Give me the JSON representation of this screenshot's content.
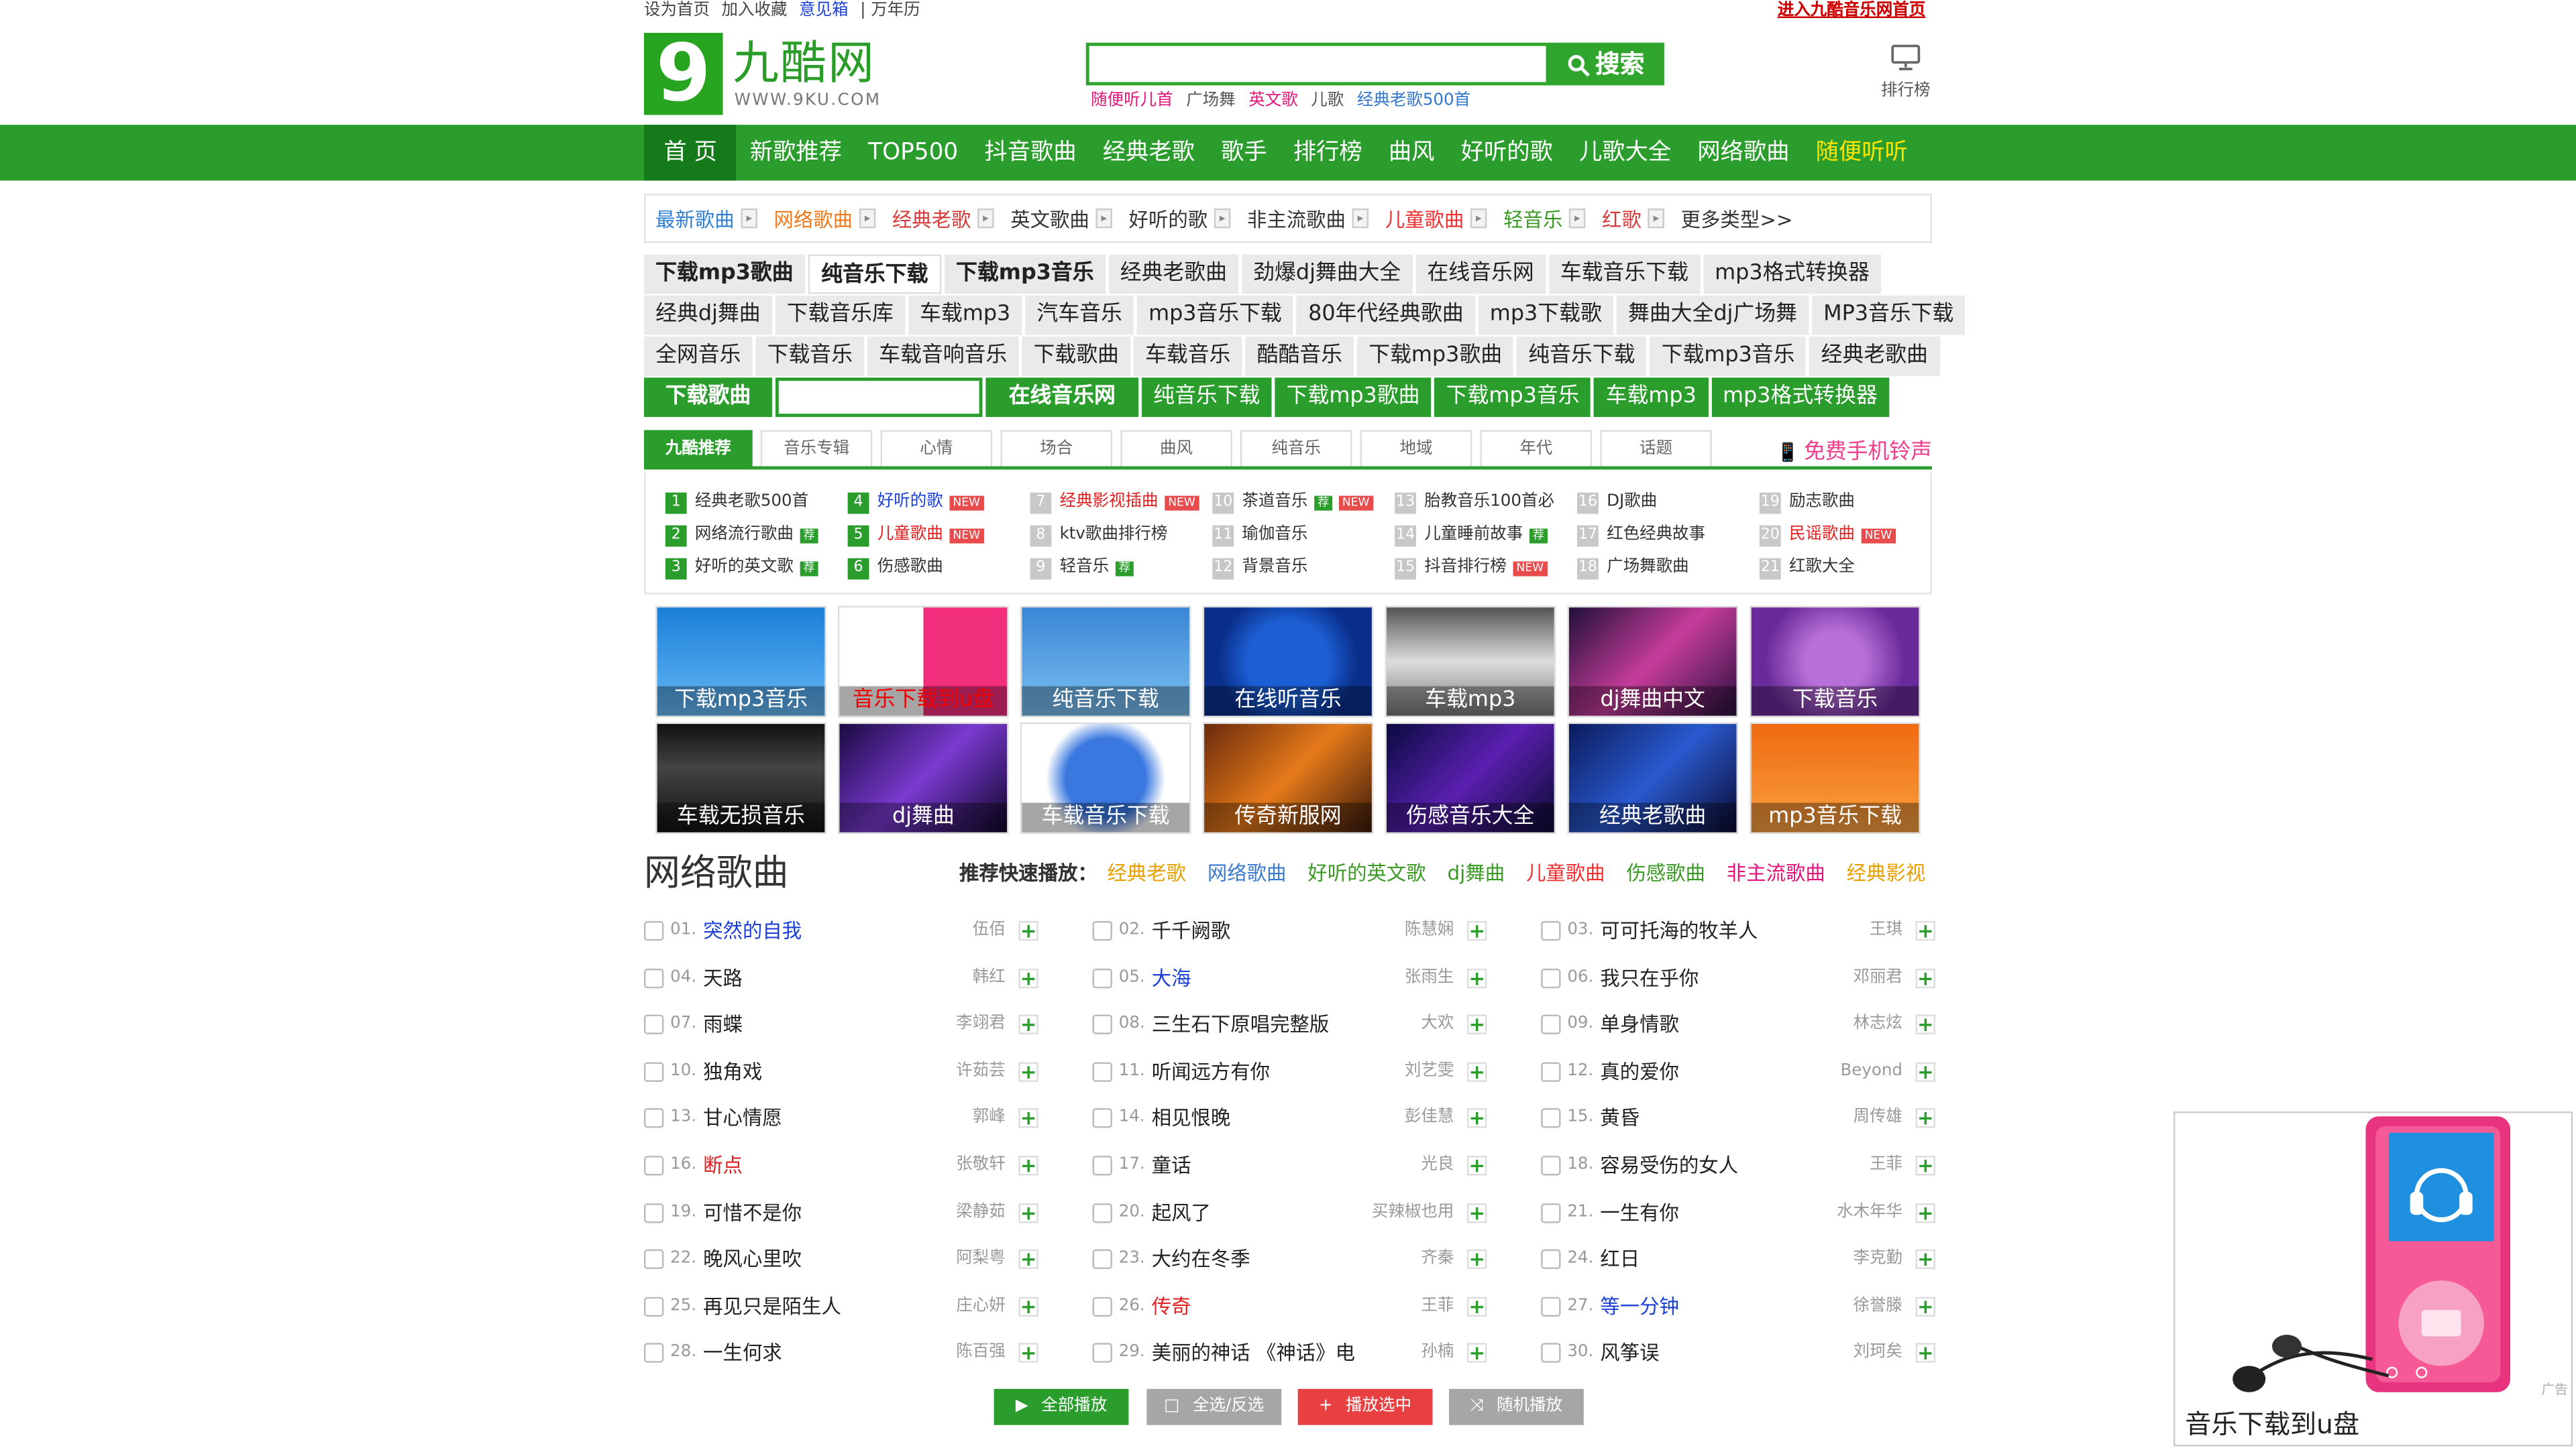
{
  "topbar": {
    "links": [
      "设为首页",
      "加入收藏",
      "意见箱",
      "| 万年历"
    ],
    "right_link": "进入九酷音乐网首页"
  },
  "logo": {
    "digit": "9",
    "cn": "九酷网",
    "en": "WWW.9KU.COM"
  },
  "search": {
    "placeholder": "",
    "button": "搜索",
    "hot": [
      {
        "t": "随便听儿首",
        "c": "#e4147a"
      },
      {
        "t": "广场舞",
        "c": "#555"
      },
      {
        "t": "英文歌",
        "c": "#e4147a"
      },
      {
        "t": "儿歌",
        "c": "#555"
      },
      {
        "t": "经典老歌500首",
        "c": "#3377cc"
      }
    ]
  },
  "rank": {
    "label": "排行榜",
    "icon": "monitor-icon"
  },
  "nav": {
    "items": [
      "首 页",
      "新歌推荐",
      "TOP500",
      "抖音歌曲",
      "经典老歌",
      "歌手",
      "排行榜",
      "曲风",
      "好听的歌",
      "儿歌大全",
      "网络歌曲",
      "随便听听"
    ]
  },
  "types": [
    {
      "t": "最新歌曲",
      "c": "#2f7fd2"
    },
    {
      "t": "网络歌曲",
      "c": "#f07a1a"
    },
    {
      "t": "经典老歌",
      "c": "#d43a3a"
    },
    {
      "t": "英文歌曲",
      "c": "#333"
    },
    {
      "t": "好听的歌",
      "c": "#333"
    },
    {
      "t": "非主流歌曲",
      "c": "#333"
    },
    {
      "t": "儿童歌曲",
      "c": "#f03030"
    },
    {
      "t": "轻音乐",
      "c": "#3a9a24"
    },
    {
      "t": "红歌",
      "c": "#d43a3a"
    },
    {
      "t": "更多类型>>",
      "c": "#333"
    }
  ],
  "grid": {
    "row1": [
      {
        "t": "下载mp3歌曲",
        "b": 1
      },
      {
        "t": "纯音乐下载",
        "b": 1,
        "w": 1
      },
      {
        "t": "下载mp3音乐",
        "b": 1
      },
      {
        "t": "经典老歌曲"
      },
      {
        "t": "劲爆dj舞曲大全"
      },
      {
        "t": "在线音乐网"
      },
      {
        "t": "车载音乐下载"
      },
      {
        "t": "mp3格式转换器"
      }
    ],
    "row2": [
      {
        "t": "经典dj舞曲"
      },
      {
        "t": "下载音乐库"
      },
      {
        "t": "车载mp3"
      },
      {
        "t": "汽车音乐"
      },
      {
        "t": "mp3音乐下载"
      },
      {
        "t": "80年代经典歌曲"
      },
      {
        "t": "mp3下载歌"
      },
      {
        "t": "舞曲大全dj广场舞"
      },
      {
        "t": "MP3音乐下载"
      }
    ],
    "row3": [
      {
        "t": "全网音乐"
      },
      {
        "t": "下载音乐"
      },
      {
        "t": "车载音响音乐"
      },
      {
        "t": "下载歌曲"
      },
      {
        "t": "车载音乐"
      },
      {
        "t": "酷酷音乐"
      },
      {
        "t": "下载mp3歌曲"
      },
      {
        "t": "纯音乐下载"
      },
      {
        "t": "下载mp3音乐"
      },
      {
        "t": "经典老歌曲"
      }
    ],
    "row4_label": "下载歌曲",
    "row4_btn": "在线音乐网",
    "row4": [
      {
        "t": "纯音乐下载"
      },
      {
        "t": "下载mp3歌曲"
      },
      {
        "t": "下载mp3音乐"
      },
      {
        "t": "车载mp3"
      },
      {
        "t": "mp3格式转换器"
      }
    ]
  },
  "tabs": {
    "items": [
      "九酷推荐",
      "音乐专辑",
      "心情",
      "场合",
      "曲风",
      "纯音乐",
      "地域",
      "年代",
      "话题"
    ],
    "ring": "免费手机铃声"
  },
  "recommend": [
    [
      {
        "n": "1",
        "t": "经典老歌500首",
        "c": "#333"
      },
      {
        "n": "2",
        "t": "网络流行歌曲",
        "c": "#333",
        "tag": "荐"
      },
      {
        "n": "3",
        "t": "好听的英文歌",
        "c": "#333",
        "tag": "荐"
      }
    ],
    [
      {
        "n": "4",
        "t": "好听的歌",
        "c": "#1a3fd8",
        "tag": "NEW"
      },
      {
        "n": "5",
        "t": "儿童歌曲",
        "c": "#e02020",
        "tag": "NEW"
      },
      {
        "n": "6",
        "t": "伤感歌曲",
        "c": "#333"
      }
    ],
    [
      {
        "n": "7",
        "t": "经典影视插曲",
        "c": "#e02020",
        "tag": "NEW"
      },
      {
        "n": "8",
        "t": "ktv歌曲排行榜",
        "c": "#333"
      },
      {
        "n": "9",
        "t": "轻音乐",
        "c": "#333",
        "tag": "荐"
      }
    ],
    [
      {
        "n": "10",
        "t": "茶道音乐",
        "c": "#333",
        "tag": "荐",
        "tag2": "NEW"
      },
      {
        "n": "11",
        "t": "瑜伽音乐",
        "c": "#333"
      },
      {
        "n": "12",
        "t": "背景音乐",
        "c": "#333"
      }
    ],
    [
      {
        "n": "13",
        "t": "胎教音乐100首必",
        "c": "#333"
      },
      {
        "n": "14",
        "t": "儿童睡前故事",
        "c": "#333",
        "tag": "荐"
      },
      {
        "n": "15",
        "t": "抖音排行榜",
        "c": "#333",
        "tag": "NEW"
      }
    ],
    [
      {
        "n": "16",
        "t": "DJ歌曲",
        "c": "#333"
      },
      {
        "n": "17",
        "t": "红色经典故事",
        "c": "#333"
      },
      {
        "n": "18",
        "t": "广场舞歌曲",
        "c": "#333"
      }
    ],
    [
      {
        "n": "19",
        "t": "励志歌曲",
        "c": "#333"
      },
      {
        "n": "20",
        "t": "民谣歌曲",
        "c": "#e02020",
        "tag": "NEW"
      },
      {
        "n": "21",
        "t": "红歌大全",
        "c": "#333"
      }
    ]
  ],
  "thumbs": [
    {
      "t": "下载mp3音乐",
      "bg": "linear-gradient(#1a7fd8,#66b8f5)"
    },
    {
      "t": "音乐下载到u盘",
      "bg": "linear-gradient(90deg,#fff 50%,#f02e7c 50%)",
      "cc": "#e00"
    },
    {
      "t": "纯音乐下载",
      "bg": "linear-gradient(#3a86d6,#7cc0f0)"
    },
    {
      "t": "在线听音乐",
      "bg": "radial-gradient(circle,#1c5fd4 40%,#0a2f8a 70%)"
    },
    {
      "t": "车载mp3",
      "bg": "linear-gradient(#555,#ddd 50%,#777)"
    },
    {
      "t": "dj舞曲中文",
      "bg": "linear-gradient(135deg,#20103a,#c63c9a,#2a1040)"
    },
    {
      "t": "下载音乐",
      "bg": "radial-gradient(circle,#b870d8 30%,#6a2b9a 70%)"
    },
    {
      "t": "车载无损音乐",
      "bg": "linear-gradient(#111,#444 40%,#111)"
    },
    {
      "t": "dj舞曲",
      "bg": "linear-gradient(135deg,#1a0a40,#7a3ad0,#10062a)"
    },
    {
      "t": "车载音乐下载",
      "bg": "radial-gradient(circle,#3a78e0 40%,#fff 60%)"
    },
    {
      "t": "传奇新服网",
      "bg": "linear-gradient(135deg,#6a2a0a,#e67a1a,#3a1a0a)"
    },
    {
      "t": "伤感音乐大全",
      "bg": "linear-gradient(135deg,#0a0a40,#5a20b0,#0a0a30)"
    },
    {
      "t": "经典老歌曲",
      "bg": "linear-gradient(135deg,#0a1a5a,#2a5ad0,#0a0a30)"
    },
    {
      "t": "mp3音乐下载",
      "bg": "linear-gradient(#f06a10,#f8a040)"
    }
  ],
  "section": {
    "title": "网络歌曲",
    "quick_label": "推荐快速播放：",
    "quick": [
      {
        "t": "经典老歌",
        "c": "#e8a000"
      },
      {
        "t": "网络歌曲",
        "c": "#3a7ad0"
      },
      {
        "t": "好听的英文歌",
        "c": "#3a9a24"
      },
      {
        "t": "dj舞曲",
        "c": "#3a9a24"
      },
      {
        "t": "儿童歌曲",
        "c": "#f03030"
      },
      {
        "t": "伤感歌曲",
        "c": "#3a9a24"
      },
      {
        "t": "非主流歌曲",
        "c": "#e0147a"
      },
      {
        "t": "经典影视",
        "c": "#e8a000"
      }
    ]
  },
  "songs": [
    {
      "no": "01.",
      "t": "突然的自我",
      "a": "伍佰",
      "c": "#1a3fd8"
    },
    {
      "no": "02.",
      "t": "千千阙歌",
      "a": "陈慧娴",
      "c": "#222"
    },
    {
      "no": "03.",
      "t": "可可托海的牧羊人",
      "a": "王琪",
      "c": "#222"
    },
    {
      "no": "04.",
      "t": "天路",
      "a": "韩红",
      "c": "#222"
    },
    {
      "no": "05.",
      "t": "大海",
      "a": "张雨生",
      "c": "#1a3fd8"
    },
    {
      "no": "06.",
      "t": "我只在乎你",
      "a": "邓丽君",
      "c": "#222"
    },
    {
      "no": "07.",
      "t": "雨蝶",
      "a": "李翊君",
      "c": "#222"
    },
    {
      "no": "08.",
      "t": "三生石下原唱完整版",
      "a": "大欢",
      "c": "#222"
    },
    {
      "no": "09.",
      "t": "单身情歌",
      "a": "林志炫",
      "c": "#222"
    },
    {
      "no": "10.",
      "t": "独角戏",
      "a": "许茹芸",
      "c": "#222"
    },
    {
      "no": "11.",
      "t": "听闻远方有你",
      "a": "刘艺雯",
      "c": "#222"
    },
    {
      "no": "12.",
      "t": "真的爱你",
      "a": "Beyond",
      "c": "#222"
    },
    {
      "no": "13.",
      "t": "甘心情愿",
      "a": "郭峰",
      "c": "#222"
    },
    {
      "no": "14.",
      "t": "相见恨晚",
      "a": "彭佳慧",
      "c": "#222"
    },
    {
      "no": "15.",
      "t": "黄昏",
      "a": "周传雄",
      "c": "#222"
    },
    {
      "no": "16.",
      "t": "断点",
      "a": "张敬轩",
      "c": "#e02020"
    },
    {
      "no": "17.",
      "t": "童话",
      "a": "光良",
      "c": "#222"
    },
    {
      "no": "18.",
      "t": "容易受伤的女人",
      "a": "王菲",
      "c": "#222"
    },
    {
      "no": "19.",
      "t": "可惜不是你",
      "a": "梁静茹",
      "c": "#222"
    },
    {
      "no": "20.",
      "t": "起风了",
      "a": "买辣椒也用",
      "c": "#222"
    },
    {
      "no": "21.",
      "t": "一生有你",
      "a": "水木年华",
      "c": "#222"
    },
    {
      "no": "22.",
      "t": "晚风心里吹",
      "a": "阿梨粤",
      "c": "#222"
    },
    {
      "no": "23.",
      "t": "大约在冬季",
      "a": "齐秦",
      "c": "#222"
    },
    {
      "no": "24.",
      "t": "红日",
      "a": "李克勤",
      "c": "#222"
    },
    {
      "no": "25.",
      "t": "再见只是陌生人",
      "a": "庄心妍",
      "c": "#222"
    },
    {
      "no": "26.",
      "t": "传奇",
      "a": "王菲",
      "c": "#e02020"
    },
    {
      "no": "27.",
      "t": "等一分钟",
      "a": "徐誉滕",
      "c": "#1a3fd8"
    },
    {
      "no": "28.",
      "t": "一生何求",
      "a": "陈百强",
      "c": "#222"
    },
    {
      "no": "29.",
      "t": "美丽的神话 《神话》电",
      "a": "孙楠",
      "c": "#222"
    },
    {
      "no": "30.",
      "t": "风筝误",
      "a": "刘珂矣",
      "c": "#222"
    }
  ],
  "actions": [
    {
      "t": "全部播放",
      "c": "#2a9d2c",
      "i": "▶"
    },
    {
      "t": "全选/反选",
      "c": "#a6a6a6",
      "i": "□"
    },
    {
      "t": "播放选中",
      "c": "#e84040",
      "i": "+"
    },
    {
      "t": "随机播放",
      "c": "#a6a6a6",
      "i": "⤨"
    }
  ],
  "ad": {
    "caption": "音乐下载到u盘",
    "mark": "广告"
  },
  "colors": {
    "brand": "#2a9d2c",
    "nav_active": "#157a1a"
  }
}
